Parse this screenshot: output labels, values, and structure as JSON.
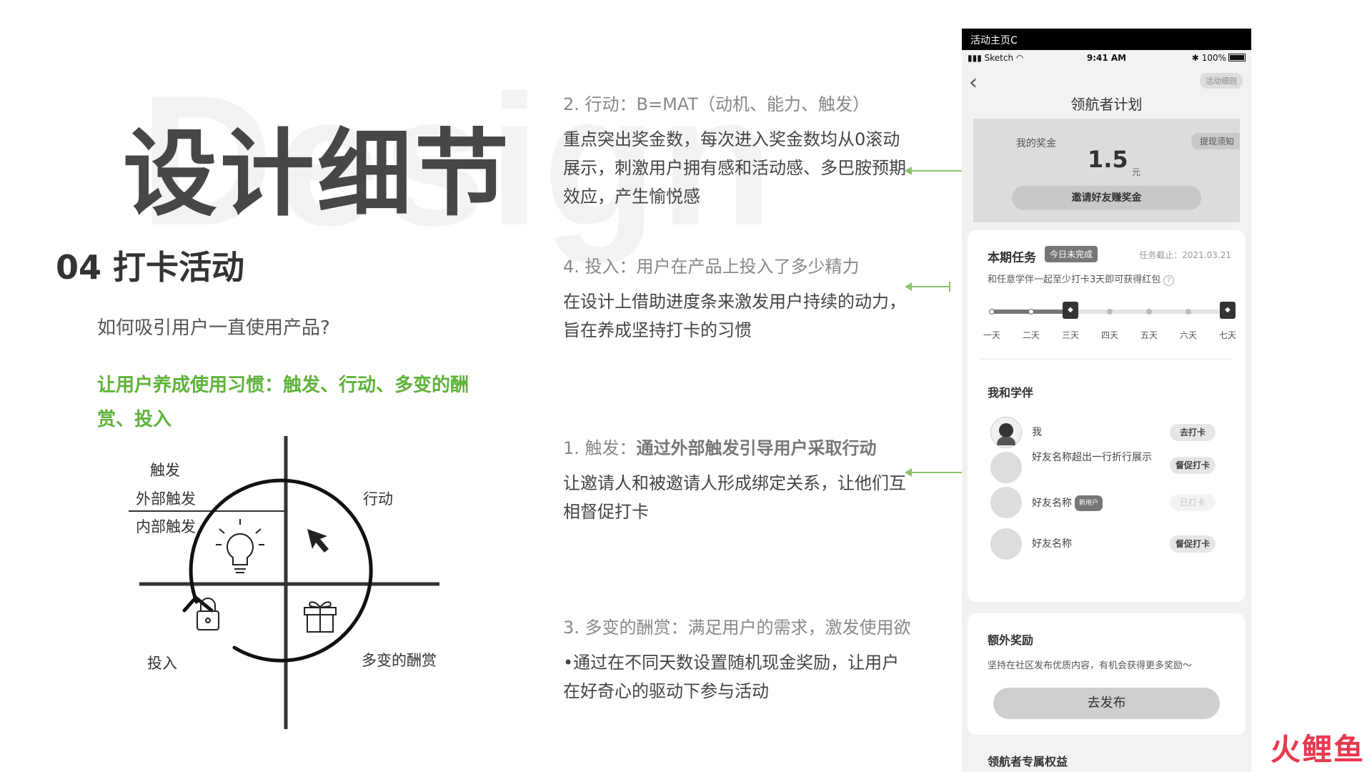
{
  "watermark": "Design",
  "big_title": "设计细节",
  "section_title": "04 打卡活动",
  "question": "如何吸引用户一直使用产品?",
  "highlight": "让用户养成使用习惯：触发、行动、多变的酬赏、投入",
  "hook_model": {
    "trigger": "触发",
    "external_trigger": "外部触发",
    "internal_trigger": "内部触发",
    "action": "行动",
    "investment": "投入",
    "variable_reward": "多变的酬赏",
    "icons": [
      "lightbulb-icon",
      "cursor-click-icon",
      "lock-icon",
      "gift-icon"
    ]
  },
  "steps": {
    "action": {
      "title": "2.  行动：B=MAT（动机、能力、触发）",
      "body": "重点突出奖金数，每次进入奖金数均从0滚动展示，刺激用户拥有感和活动感、多巴胺预期效应，产生愉悦感"
    },
    "investment": {
      "title": "4.  投入：用户在产品上投入了多少精力",
      "body": "在设计上借助进度条来激发用户持续的动力，旨在养成坚持打卡的习惯"
    },
    "trigger": {
      "title_prefix": "1.  触发：",
      "title_strong": "通过外部触发引导用户采取行动",
      "body": "让邀请人和被邀请人形成绑定关系，让他们互相督促打卡"
    },
    "reward": {
      "title": "3.  多变的酬赏：满足用户的需求，激发使用欲",
      "body": "•通过在不同天数设置随机现金奖励，让用户在好奇心的驱动下参与活动"
    }
  },
  "phone": {
    "window_title": "活动主页C",
    "status": {
      "carrier": "Sketch",
      "time": "9:41 AM",
      "battery": "100%"
    },
    "rules_label": "活动细则",
    "page_title": "领航者计划",
    "bonus": {
      "label": "我的奖金",
      "withdraw": "提现须知",
      "amount": "1.5",
      "unit": "元",
      "invite_button": "邀请好友赚奖金"
    },
    "task": {
      "title": "本期任务",
      "badge": "今日未完成",
      "deadline": "任务截止：2021.03.21",
      "desc": "和任意学伴一起至少打卡3天即可获得红包",
      "days": [
        "一天",
        "二天",
        "三天",
        "四天",
        "五天",
        "六天",
        "七天"
      ],
      "progress": 0.333
    },
    "buddies": {
      "title": "我和学伴",
      "list": [
        {
          "name": "我",
          "action": "去打卡",
          "state": "active"
        },
        {
          "name": "好友名称超出一行折行展示",
          "action": "督促打卡",
          "state": "active"
        },
        {
          "name": "好友名称",
          "badge": "新用户",
          "action": "已打卡",
          "state": "disabled"
        },
        {
          "name": "好友名称",
          "action": "督促打卡",
          "state": "active"
        }
      ]
    },
    "extra": {
      "title": "额外奖励",
      "desc": "坚持在社区发布优质内容，有机会获得更多奖励～",
      "button": "去发布"
    },
    "perks_title": "领航者专属权益"
  },
  "brand_logo": "火鲤鱼",
  "colors": {
    "accent_green": "#5fb33b",
    "arrow_green": "#8bc46a",
    "logo_red": "#e8384f"
  }
}
